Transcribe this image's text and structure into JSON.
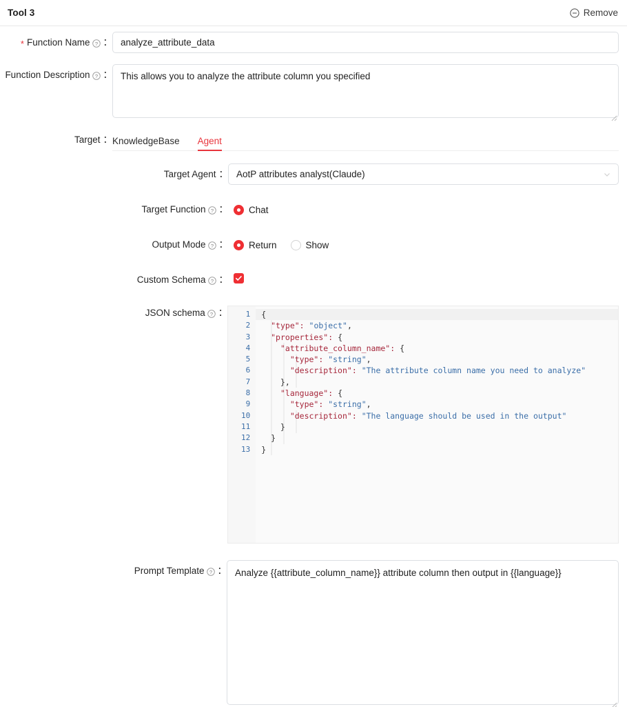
{
  "header": {
    "title": "Tool 3",
    "remove_label": "Remove",
    "remove_icon": "circle-minus-icon"
  },
  "form": {
    "function_name": {
      "label": "Function Name",
      "required_marker": "*",
      "colon": "：",
      "value": "analyze_attribute_data",
      "help_icon": "question-circle-icon"
    },
    "function_description": {
      "label": "Function Description",
      "colon": "：",
      "value": "This allows you to analyze the attribute column you specified",
      "help_icon": "question-circle-icon"
    },
    "target": {
      "label": "Target",
      "colon": "：",
      "tabs": [
        {
          "label": "KnowledgeBase",
          "active": false
        },
        {
          "label": "Agent",
          "active": true
        }
      ],
      "active_tab": "Agent"
    },
    "target_agent": {
      "label": "Target Agent",
      "colon": "：",
      "value": "AotP attributes analyst(Claude)",
      "chevron_icon": "chevron-down-icon"
    },
    "target_function": {
      "label": "Target Function",
      "colon": "：",
      "help_icon": "question-circle-icon",
      "options": [
        {
          "label": "Chat",
          "checked": true
        }
      ]
    },
    "output_mode": {
      "label": "Output Mode",
      "colon": "：",
      "help_icon": "question-circle-icon",
      "options": [
        {
          "label": "Return",
          "checked": true
        },
        {
          "label": "Show",
          "checked": false
        }
      ]
    },
    "custom_schema": {
      "label": "Custom Schema",
      "colon": "：",
      "help_icon": "question-circle-icon",
      "checked": true
    },
    "json_schema": {
      "label": "JSON schema",
      "colon": "：",
      "help_icon": "question-circle-icon",
      "line_numbers": [
        "1",
        "2",
        "3",
        "4",
        "5",
        "6",
        "7",
        "8",
        "9",
        "10",
        "11",
        "12",
        "13"
      ],
      "lines": [
        "{",
        "  \"type\": \"object\",",
        "  \"properties\": {",
        "    \"attribute_column_name\": {",
        "      \"type\": \"string\",",
        "      \"description\": \"The attribute column name you need to analyze\"",
        "    },",
        "    \"language\": {",
        "      \"type\": \"string\",",
        "      \"description\": \"The language should be used in the output\"",
        "    }",
        "  }",
        "}"
      ],
      "value": "{\n  \"type\": \"object\",\n  \"properties\": {\n    \"attribute_column_name\": {\n      \"type\": \"string\",\n      \"description\": \"The attribute column name you need to analyze\"\n    },\n    \"language\": {\n      \"type\": \"string\",\n      \"description\": \"The language should be used in the output\"\n    }\n  }\n}"
    },
    "prompt_template": {
      "label": "Prompt Template",
      "colon": "：",
      "help_icon": "question-circle-icon",
      "value": "Analyze {{attribute_column_name}} attribute column then output in {{language}}"
    }
  },
  "colors": {
    "accent_red": "#e8353d",
    "control_red": "#ef2f33",
    "border": "#dcdfe3",
    "code_key": "#a6273b",
    "code_string": "#3b6ea8",
    "gutter_number": "#3b6ea8"
  }
}
